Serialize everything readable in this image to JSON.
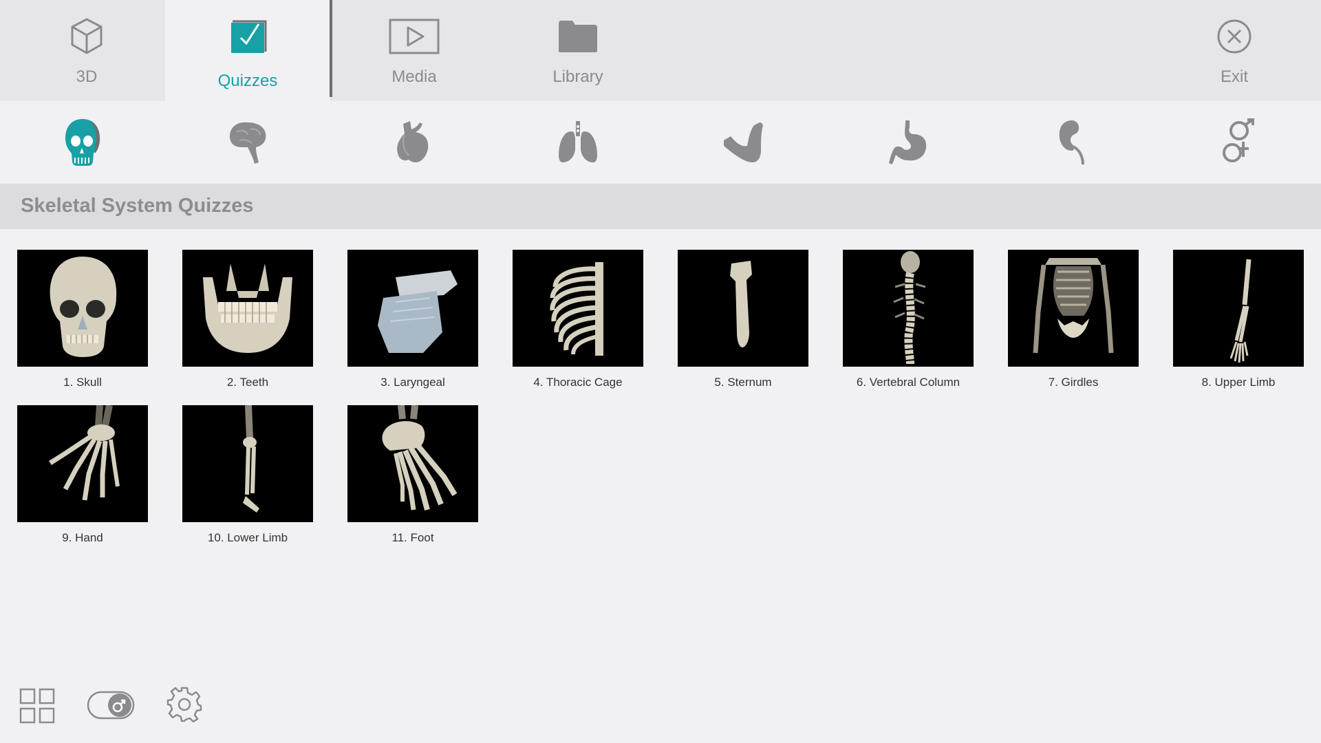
{
  "tabs": [
    {
      "label": "3D",
      "icon": "cube-icon",
      "active": false
    },
    {
      "label": "Quizzes",
      "icon": "quiz-checkbox-icon",
      "active": true
    },
    {
      "label": "Media",
      "icon": "play-icon",
      "active": false
    },
    {
      "label": "Library",
      "icon": "folder-icon",
      "active": false
    }
  ],
  "exit": {
    "label": "Exit",
    "icon": "close-circle-icon"
  },
  "systems": [
    {
      "name": "skeletal",
      "icon": "skull-icon",
      "active": true
    },
    {
      "name": "nervous",
      "icon": "brain-icon",
      "active": false
    },
    {
      "name": "cardiovascular",
      "icon": "heart-icon",
      "active": false
    },
    {
      "name": "respiratory",
      "icon": "lungs-icon",
      "active": false
    },
    {
      "name": "muscular",
      "icon": "muscle-arm-icon",
      "active": false
    },
    {
      "name": "digestive",
      "icon": "stomach-icon",
      "active": false
    },
    {
      "name": "urinary",
      "icon": "kidney-icon",
      "active": false
    },
    {
      "name": "reproductive",
      "icon": "gender-icon",
      "active": false
    }
  ],
  "section": {
    "title": "Skeletal System Quizzes"
  },
  "quizzes": [
    {
      "label": "1. Skull",
      "thumb": "skull"
    },
    {
      "label": "2. Teeth",
      "thumb": "teeth"
    },
    {
      "label": "3. Laryngeal",
      "thumb": "laryngeal"
    },
    {
      "label": "4. Thoracic Cage",
      "thumb": "thoracic-cage"
    },
    {
      "label": "5. Sternum",
      "thumb": "sternum"
    },
    {
      "label": "6. Vertebral Column",
      "thumb": "vertebral-column"
    },
    {
      "label": "7. Girdles",
      "thumb": "girdles"
    },
    {
      "label": "8. Upper Limb",
      "thumb": "upper-limb"
    },
    {
      "label": "9. Hand",
      "thumb": "hand"
    },
    {
      "label": "10. Lower Limb",
      "thumb": "lower-limb"
    },
    {
      "label": "11. Foot",
      "thumb": "foot"
    }
  ],
  "toolbar": {
    "grid": "grid-view-icon",
    "gender_toggle": "male-toggle-icon",
    "settings": "gear-icon"
  },
  "colors": {
    "accent": "#17a1a6",
    "icon_gray": "#8b8b8f",
    "bone": "#d8d2c0"
  }
}
